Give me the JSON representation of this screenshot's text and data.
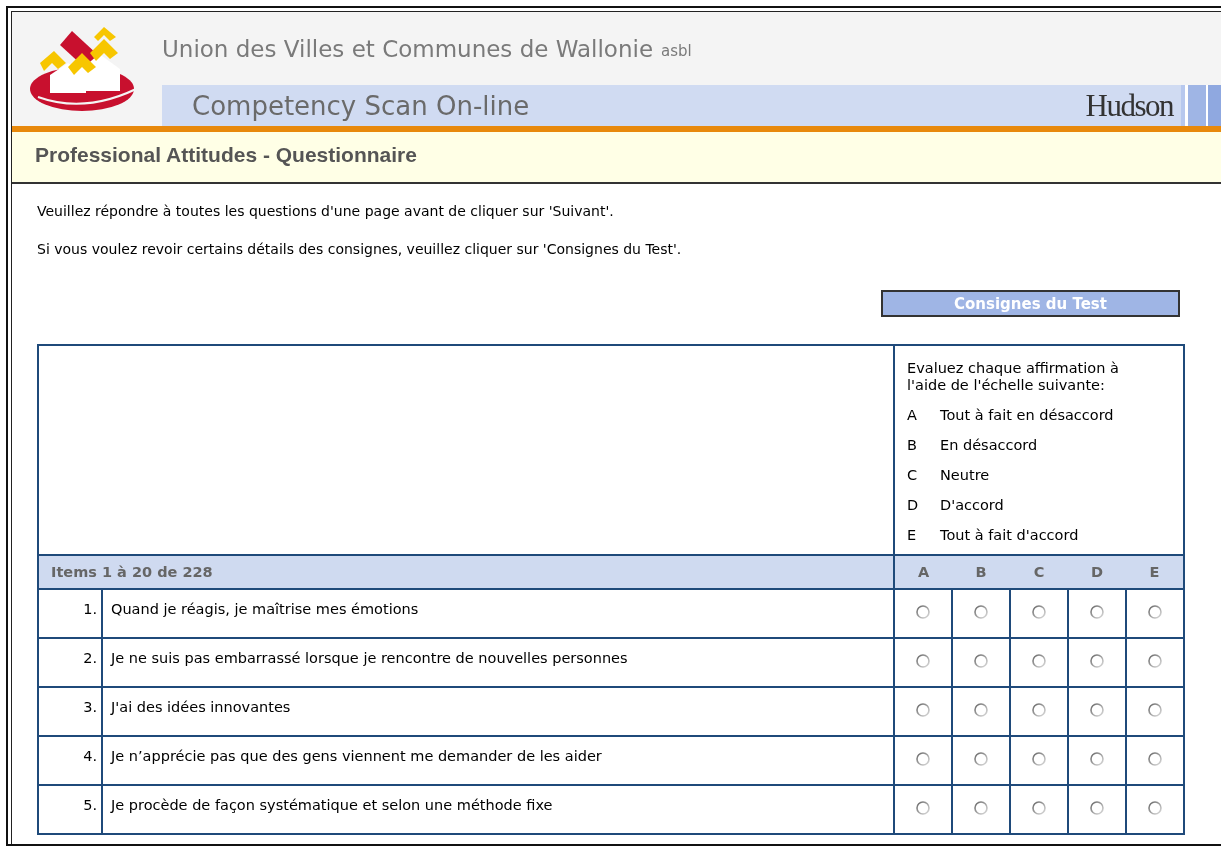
{
  "header": {
    "organization": "Union des Villes et Communes de Wallonie",
    "organization_suffix": "asbl",
    "product": "Competency Scan On-line",
    "partner_logo": "Hudson"
  },
  "page_title": "Professional Attitudes - Questionnaire",
  "instructions": [
    "Veuillez répondre à toutes les questions d'une page avant de cliquer sur 'Suivant'.",
    "Si vous voulez revoir certains détails des consignes, veuillez cliquer sur 'Consignes du Test'."
  ],
  "instructions_button": "Consignes du Test",
  "scale": {
    "intro": "Evaluez chaque affirmation à l'aide de l'échelle suivante:",
    "levels": [
      {
        "letter": "A",
        "label": "Tout à fait en désaccord"
      },
      {
        "letter": "B",
        "label": "En désaccord"
      },
      {
        "letter": "C",
        "label": "Neutre"
      },
      {
        "letter": "D",
        "label": "D'accord"
      },
      {
        "letter": "E",
        "label": "Tout à fait d'accord"
      }
    ]
  },
  "table": {
    "range_label": "Items 1 à 20 de 228",
    "columns": [
      "A",
      "B",
      "C",
      "D",
      "E"
    ],
    "rows": [
      {
        "number": "1.",
        "statement": "Quand je réagis, je maîtrise mes émotions",
        "options": [
          {
            "selected": false
          },
          {
            "selected": false
          },
          {
            "selected": false
          },
          {
            "selected": false
          },
          {
            "selected": false
          }
        ]
      },
      {
        "number": "2.",
        "statement": "Je ne suis pas embarrassé lorsque je rencontre de nouvelles personnes",
        "options": [
          {
            "selected": false
          },
          {
            "selected": false
          },
          {
            "selected": false
          },
          {
            "selected": false
          },
          {
            "selected": false
          }
        ]
      },
      {
        "number": "3.",
        "statement": "J'ai des idées innovantes",
        "options": [
          {
            "selected": false
          },
          {
            "selected": false
          },
          {
            "selected": false
          },
          {
            "selected": false
          },
          {
            "selected": false
          }
        ]
      },
      {
        "number": "4.",
        "statement": "Je n’apprécie pas que des gens viennent me demander de les aider",
        "options": [
          {
            "selected": false
          },
          {
            "selected": false
          },
          {
            "selected": false
          },
          {
            "selected": false
          },
          {
            "selected": false
          }
        ]
      },
      {
        "number": "5.",
        "statement": "Je procède de façon systématique et selon une méthode fixe",
        "options": [
          {
            "selected": false
          },
          {
            "selected": false
          },
          {
            "selected": false
          },
          {
            "selected": false
          },
          {
            "selected": false
          }
        ]
      }
    ]
  }
}
